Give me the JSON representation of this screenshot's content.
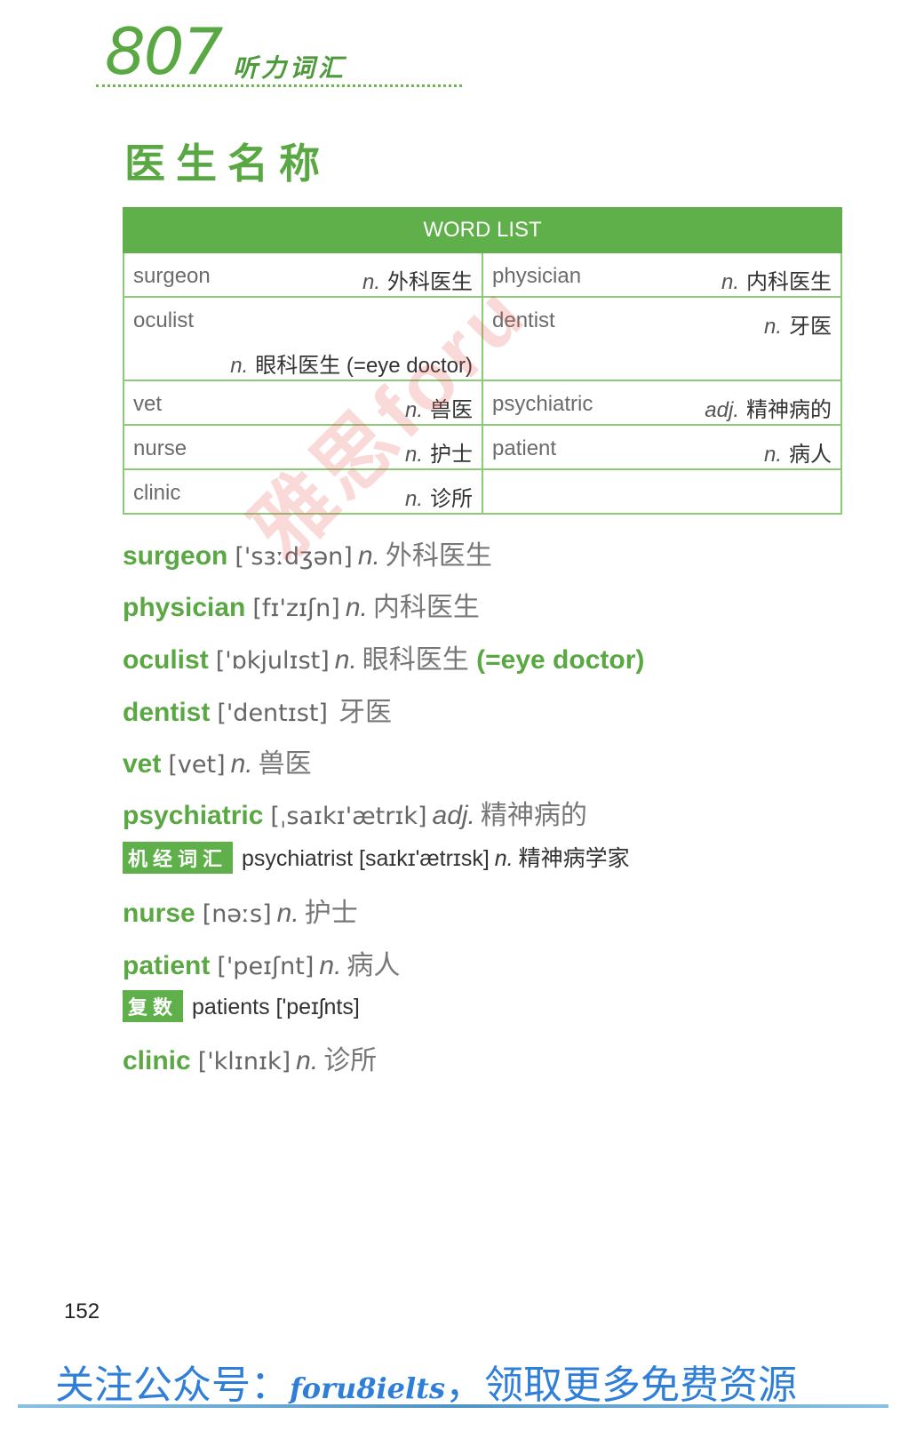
{
  "header": {
    "number": "807",
    "subtitle": "听力词汇"
  },
  "section_title": "医生名称",
  "word_list": {
    "header": "WORD LIST",
    "rows": [
      [
        {
          "word": "surgeon",
          "pos": "n.",
          "meaning": "外科医生"
        },
        {
          "word": "physician",
          "pos": "n.",
          "meaning": "内科医生"
        }
      ],
      [
        {
          "word": "oculist",
          "pos": "n.",
          "meaning": "眼科医生 (=eye doctor)"
        },
        {
          "word": "dentist",
          "pos": "n.",
          "meaning": "牙医"
        }
      ],
      [
        {
          "word": "vet",
          "pos": "n.",
          "meaning": "兽医"
        },
        {
          "word": "psychiatric",
          "pos": "adj.",
          "meaning": "精神病的"
        }
      ],
      [
        {
          "word": "nurse",
          "pos": "n.",
          "meaning": "护士"
        },
        {
          "word": "patient",
          "pos": "n.",
          "meaning": "病人"
        }
      ],
      [
        {
          "word": "clinic",
          "pos": "n.",
          "meaning": "诊所"
        },
        {
          "word": "",
          "pos": "",
          "meaning": ""
        }
      ]
    ]
  },
  "entries": [
    {
      "word": "surgeon",
      "ipa": "['sɜːdʒən]",
      "pos": "n.",
      "meaning": "外科医生",
      "extra": ""
    },
    {
      "word": "physician",
      "ipa": "[fɪ'zɪʃn]",
      "pos": "n.",
      "meaning": "内科医生",
      "extra": ""
    },
    {
      "word": "oculist",
      "ipa": "['ɒkjulɪst]",
      "pos": "n.",
      "meaning": "眼科医生",
      "extra": "(=eye doctor)"
    },
    {
      "word": "dentist",
      "ipa": "['dentɪst]",
      "pos": "",
      "meaning": "牙医",
      "extra": ""
    },
    {
      "word": "vet",
      "ipa": "[vet]",
      "pos": "n.",
      "meaning": "兽医",
      "extra": ""
    },
    {
      "word": "psychiatric",
      "ipa": "[ˌsaɪkɪ'ætrɪk]",
      "pos": "adj.",
      "meaning": "精神病的",
      "extra": ""
    },
    {
      "word": "nurse",
      "ipa": "[nəːs]",
      "pos": "n.",
      "meaning": "护士",
      "extra": ""
    },
    {
      "word": "patient",
      "ipa": "['peɪʃnt]",
      "pos": "n.",
      "meaning": "病人",
      "extra": ""
    },
    {
      "word": "clinic",
      "ipa": "['klɪnɪk]",
      "pos": "n.",
      "meaning": "诊所",
      "extra": ""
    }
  ],
  "subentries": [
    {
      "badge": "机经词汇",
      "word": "psychiatrist",
      "ipa": "[saɪkɪ'ætrɪsk]",
      "pos": "n.",
      "meaning": "精神病学家"
    },
    {
      "badge": "复数",
      "word": "patients",
      "ipa": "['peɪʃnts]",
      "pos": "",
      "meaning": ""
    }
  ],
  "page_number": "152",
  "footer": {
    "text_before": "关注公众号：",
    "brand": "foru8ielts",
    "text_after": "，领取更多免费资源"
  },
  "watermark": "雅思foru"
}
